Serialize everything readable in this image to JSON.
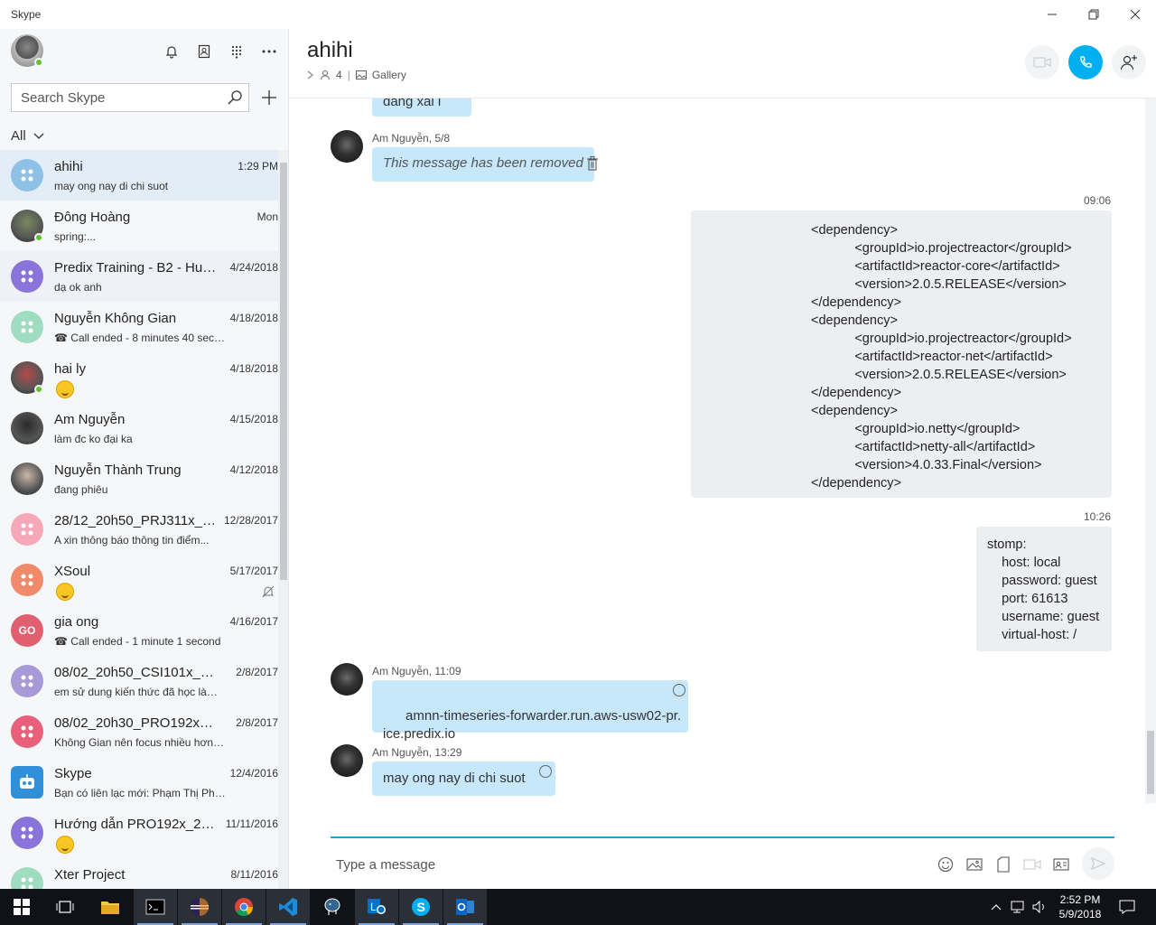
{
  "window": {
    "title": "Skype"
  },
  "sidebar": {
    "search_placeholder": "Search Skype",
    "filter_label": "All",
    "conversations": [
      {
        "name": "ahihi",
        "time": "1:29 PM",
        "preview": "may ong nay di chi suot",
        "avatar_color": "#8fc0e6",
        "avatar_type": "group"
      },
      {
        "name": "Đông Hoàng",
        "time": "Mon",
        "preview": "spring:...",
        "avatar_color": "#7a8a60",
        "avatar_type": "photo",
        "online": true
      },
      {
        "name": "Predix Training - B2 - Huy...",
        "time": "4/24/2018",
        "preview": "dạ ok anh",
        "avatar_color": "#8a73d9",
        "avatar_type": "group"
      },
      {
        "name": "Nguyễn Không Gian",
        "time": "4/18/2018",
        "preview": "☎ Call ended - 8 minutes 40 seconds",
        "avatar_color": "#9fdcc0",
        "avatar_type": "group"
      },
      {
        "name": "hai ly",
        "time": "4/18/2018",
        "preview": "",
        "avatar_color": "#b44a4a",
        "avatar_type": "photo",
        "online": true,
        "emoji": "smile"
      },
      {
        "name": "Am Nguyễn",
        "time": "4/15/2018",
        "preview": "làm đc ko đại ka",
        "avatar_color": "#2b2b2b",
        "avatar_type": "photo"
      },
      {
        "name": "Nguyễn Thành Trung",
        "time": "4/12/2018",
        "preview": "đang phiêu",
        "avatar_color": "#c9b7a6",
        "avatar_type": "photo"
      },
      {
        "name": "28/12_20h50_PRJ311x_N...",
        "time": "12/28/2017",
        "preview": "A xin thông báo thông tin điểm...",
        "avatar_color": "#f7a8b8",
        "avatar_type": "group"
      },
      {
        "name": "XSoul",
        "time": "5/17/2017",
        "preview": "",
        "avatar_color": "#f08a6a",
        "avatar_type": "group",
        "emoji": "grin",
        "muted": true
      },
      {
        "name": "gia ong",
        "time": "4/16/2017",
        "preview": "☎ Call ended - 1 minute 1 second",
        "avatar_color": "#e06070",
        "avatar_type": "initials",
        "initials": "GO"
      },
      {
        "name": "08/02_20h50_CSI101x_Ngu...",
        "time": "2/8/2017",
        "preview": "em sử dung kiến thức đã học làm t...",
        "avatar_color": "#a79ad6",
        "avatar_type": "group"
      },
      {
        "name": "08/02_20h30_PRO192x_Ng...",
        "time": "2/8/2017",
        "preview": "Không Gian nên focus nhiều hơn n...",
        "avatar_color": "#e8607a",
        "avatar_type": "group"
      },
      {
        "name": "Skype",
        "time": "12/4/2016",
        "preview": "Bạn có liên lạc mới: Phạm Thị Phư...",
        "avatar_color": "#2f8fd8",
        "avatar_type": "bot"
      },
      {
        "name": "Hướng dẫn PRO192x_20...",
        "time": "11/11/2016",
        "preview": "",
        "avatar_color": "#8a73d9",
        "avatar_type": "group",
        "emoji": "grin"
      },
      {
        "name": "Xter Project",
        "time": "8/11/2016",
        "preview": "",
        "avatar_color": "#9fdcc0",
        "avatar_type": "group"
      }
    ]
  },
  "chat": {
    "title": "ahihi",
    "participants": "4",
    "gallery_label": "Gallery",
    "messages": {
      "partial_text": "đang xài i",
      "m1_sender": "Am Nguyễn, 5/8",
      "m1_text": "This message has been removed",
      "m2_time": "09:06",
      "m2_text": "<dependency>\n            <groupId>io.projectreactor</groupId>\n            <artifactId>reactor-core</artifactId>\n            <version>2.0.5.RELEASE</version>\n</dependency>\n<dependency>\n            <groupId>io.projectreactor</groupId>\n            <artifactId>reactor-net</artifactId>\n            <version>2.0.5.RELEASE</version>\n</dependency>\n<dependency>\n            <groupId>io.netty</groupId>\n            <artifactId>netty-all</artifactId>\n            <version>4.0.33.Final</version>\n</dependency>",
      "m3_time": "10:26",
      "m3_text": "stomp:\n    host: local\n    password: guest\n    port: 61613\n    username: guest\n    virtual-host: /",
      "m4_sender": "Am Nguyễn, 11:09",
      "m4_text": "amnn-timeseries-forwarder.run.aws-usw02-pr.\nice.predix.io",
      "m5_sender": "Am Nguyễn, 13:29",
      "m5_text": "may ong nay di chi suot"
    },
    "composer_placeholder": "Type a message"
  },
  "taskbar": {
    "time": "2:52 PM",
    "date": "5/9/2018"
  },
  "colors": {
    "accent": "#00aff0",
    "bubble_in": "#c7e7fb",
    "bubble_out": "#eceef2",
    "online": "#5fc32f"
  }
}
